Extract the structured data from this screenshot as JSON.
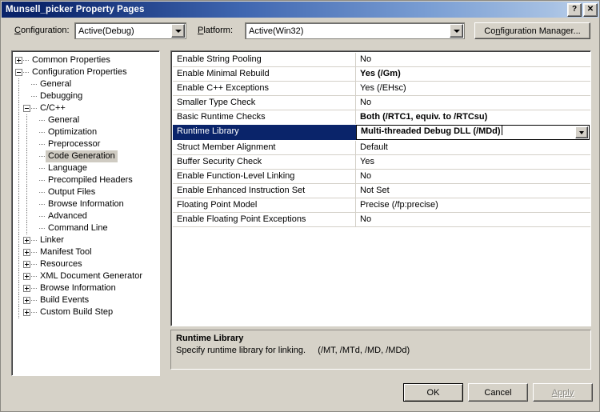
{
  "window": {
    "title": "Munsell_picker Property Pages",
    "help_button": "?",
    "close_button": "✕"
  },
  "toolbar": {
    "configuration_label": "Configuration:",
    "configuration_value": "Active(Debug)",
    "platform_label": "Platform:",
    "platform_value": "Active(Win32)",
    "configuration_manager_label": "Configuration Manager..."
  },
  "tree": {
    "nodes": [
      {
        "label": "Common Properties",
        "level": 0,
        "toggle": "plus"
      },
      {
        "label": "Configuration Properties",
        "level": 0,
        "toggle": "minus"
      },
      {
        "label": "General",
        "level": 1,
        "toggle": "none"
      },
      {
        "label": "Debugging",
        "level": 1,
        "toggle": "none"
      },
      {
        "label": "C/C++",
        "level": 1,
        "toggle": "minus"
      },
      {
        "label": "General",
        "level": 2,
        "toggle": "none"
      },
      {
        "label": "Optimization",
        "level": 2,
        "toggle": "none"
      },
      {
        "label": "Preprocessor",
        "level": 2,
        "toggle": "none"
      },
      {
        "label": "Code Generation",
        "level": 2,
        "toggle": "none",
        "selected": true
      },
      {
        "label": "Language",
        "level": 2,
        "toggle": "none"
      },
      {
        "label": "Precompiled Headers",
        "level": 2,
        "toggle": "none"
      },
      {
        "label": "Output Files",
        "level": 2,
        "toggle": "none"
      },
      {
        "label": "Browse Information",
        "level": 2,
        "toggle": "none"
      },
      {
        "label": "Advanced",
        "level": 2,
        "toggle": "none"
      },
      {
        "label": "Command Line",
        "level": 2,
        "toggle": "none"
      },
      {
        "label": "Linker",
        "level": 1,
        "toggle": "plus"
      },
      {
        "label": "Manifest Tool",
        "level": 1,
        "toggle": "plus"
      },
      {
        "label": "Resources",
        "level": 1,
        "toggle": "plus"
      },
      {
        "label": "XML Document Generator",
        "level": 1,
        "toggle": "plus"
      },
      {
        "label": "Browse Information",
        "level": 1,
        "toggle": "plus"
      },
      {
        "label": "Build Events",
        "level": 1,
        "toggle": "plus"
      },
      {
        "label": "Custom Build Step",
        "level": 1,
        "toggle": "plus"
      }
    ]
  },
  "grid": {
    "rows": [
      {
        "name": "Enable String Pooling",
        "value": "No",
        "bold": false
      },
      {
        "name": "Enable Minimal Rebuild",
        "value": "Yes (/Gm)",
        "bold": true
      },
      {
        "name": "Enable C++ Exceptions",
        "value": "Yes (/EHsc)",
        "bold": false
      },
      {
        "name": "Smaller Type Check",
        "value": "No",
        "bold": false
      },
      {
        "name": "Basic Runtime Checks",
        "value": "Both (/RTC1, equiv. to /RTCsu)",
        "bold": true
      },
      {
        "name": "Runtime Library",
        "value": "Multi-threaded Debug DLL (/MDd)",
        "bold": true,
        "selected": true
      },
      {
        "name": "Struct Member Alignment",
        "value": "Default",
        "bold": false
      },
      {
        "name": "Buffer Security Check",
        "value": "Yes",
        "bold": false
      },
      {
        "name": "Enable Function-Level Linking",
        "value": "No",
        "bold": false
      },
      {
        "name": "Enable Enhanced Instruction Set",
        "value": "Not Set",
        "bold": false
      },
      {
        "name": "Floating Point Model",
        "value": "Precise (/fp:precise)",
        "bold": false
      },
      {
        "name": "Enable Floating Point Exceptions",
        "value": "No",
        "bold": false
      }
    ]
  },
  "description": {
    "title": "Runtime Library",
    "body": "Specify runtime library for linking.     (/MT, /MTd, /MD, /MDd)"
  },
  "buttons": {
    "ok": "OK",
    "cancel": "Cancel",
    "apply": "Apply"
  },
  "colors": {
    "titlebar_start": "#0a246a",
    "titlebar_end": "#c3d5ec",
    "dialog_bg": "#d6d2c8",
    "selection_bg": "#0a246a",
    "tree_selection_bg": "#cfcbc2"
  }
}
